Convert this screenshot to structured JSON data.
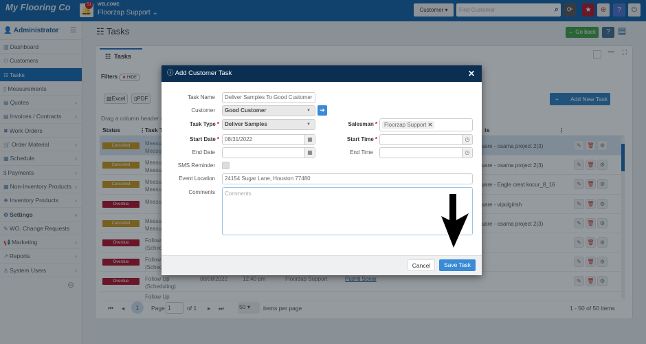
{
  "header": {
    "brand": "My Flooring Co",
    "notifications": "51",
    "welcome": "WELCOME:",
    "user": "Floorzap Support",
    "search_scope": "Customer",
    "search_placeholder": "Find Customer"
  },
  "sidebar": {
    "title": "Administrator",
    "items": [
      {
        "label": "Dashboard",
        "icon": "chart-icon"
      },
      {
        "label": "Customers",
        "icon": "users-icon"
      },
      {
        "label": "Tasks",
        "icon": "tasks-icon",
        "active": true
      },
      {
        "label": "Measurements",
        "icon": "ruler-icon"
      },
      {
        "label": "Quotes",
        "icon": "document-icon",
        "chevron": true
      },
      {
        "label": "Invoices / Contracts",
        "icon": "invoice-icon",
        "chevron": true
      },
      {
        "label": "Work Orders",
        "icon": "tools-icon"
      },
      {
        "label": "Order Material",
        "icon": "cart-icon",
        "chevron": true
      },
      {
        "label": "Schedule",
        "icon": "calendar-icon",
        "chevron": true
      },
      {
        "label": "Payments",
        "icon": "dollar-icon",
        "chevron": true
      },
      {
        "label": "Non-Inventory Products",
        "icon": "grid-icon",
        "chevron": true
      },
      {
        "label": "Inventory Products",
        "icon": "boxes-icon",
        "chevron": true
      },
      {
        "label": "Settings",
        "icon": "gear-icon",
        "chevron": true
      },
      {
        "label": "WO. Change Requests",
        "icon": "edit-icon"
      },
      {
        "label": "Marketing",
        "icon": "megaphone-icon",
        "chevron": true
      },
      {
        "label": "Reports",
        "icon": "report-icon",
        "chevron": true
      },
      {
        "label": "System Users",
        "icon": "user-icon",
        "chevron": true
      }
    ]
  },
  "page": {
    "title": "Tasks",
    "go_back": "Go back",
    "tab": "Tasks",
    "filters": "Filters",
    "hide": "HIDE",
    "excel": "Excel",
    "pdf": "PDF",
    "add_new": "Add New Task",
    "drag_hint": "Drag a column header a"
  },
  "grid": {
    "headers": {
      "status": "Status",
      "task_type": "Task T",
      "last": "ts"
    },
    "rows": [
      {
        "status": "Cancelled",
        "type": "Measu\nMeasu",
        "project": "quare - osama project 2(3)"
      },
      {
        "status": "Cancelled",
        "type": "Measu\nMeasu",
        "project": "quare - osama project 2(3)"
      },
      {
        "status": "Cancelled",
        "type": "Measu\nMeasu",
        "project": "quare - Eagle crest kocur_8_16"
      },
      {
        "status": "Overdue",
        "type": "Measu",
        "project": "quare - vipulgirish"
      },
      {
        "status": "Cancelled",
        "type": "Measu\nMeasu",
        "project": "quare - osama project 2(3)"
      },
      {
        "status": "Overdue",
        "type": "Follow\n(Sched",
        "project": ""
      },
      {
        "status": "Overdue",
        "type": "Follow\n(Sched",
        "project": ""
      },
      {
        "status": "Overdue",
        "type": "Follow Up\n(Scheduling)",
        "date": "08/08/2022",
        "time": "12:40 pm",
        "assigned": "Floorzap Support",
        "customer": "Pushti Sonar",
        "project": ""
      }
    ],
    "partial_row": "Follow Up"
  },
  "pager": {
    "current": "1",
    "page_label": "Page",
    "page_value": "1",
    "of": "of 1",
    "per_page": "50",
    "per_page_label": "items per page",
    "summary": "1 - 50 of 50 items"
  },
  "modal": {
    "title": "Add Customer Task",
    "task_name_label": "Task Name",
    "task_name": "Deliver Samples To Good Customer",
    "customer_label": "Customer",
    "customer": "Good Customer",
    "task_type_label": "Task Type",
    "task_type": "Deliver Samples",
    "salesman_label": "Salesman",
    "salesman": "Floorzap Support",
    "start_date_label": "Start Date",
    "start_date": "08/31/2022",
    "start_time_label": "Start Time",
    "start_time": "",
    "end_date_label": "End Date",
    "end_date": "",
    "end_time_label": "End Time",
    "end_time": "",
    "sms_label": "SMS Reminder",
    "sms_checked": false,
    "location_label": "Event Location",
    "location": "24154 Sugar Lane, Houston 77480",
    "comments_label": "Comments",
    "comments_placeholder": "Comments",
    "cancel": "Cancel",
    "save": "Save Task"
  },
  "colors": {
    "topbar": "#0f5fa6",
    "cancelled": "#c8951a",
    "overdue": "#b0102a",
    "save": "#3a8ad6",
    "modal_header": "#0b2f52"
  }
}
